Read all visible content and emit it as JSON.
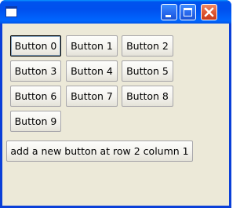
{
  "window": {
    "icons": {
      "app": "window-icon",
      "minimize": "minimize-icon",
      "maximize": "maximize-icon",
      "close": "close-icon"
    },
    "colors": {
      "titlebar": "#0053ee",
      "close_button": "#e05a36",
      "client_background": "#ece9d8"
    }
  },
  "buttons": [
    {
      "label": "Button 0"
    },
    {
      "label": "Button 1"
    },
    {
      "label": "Button 2"
    },
    {
      "label": "Button 3"
    },
    {
      "label": "Button 4"
    },
    {
      "label": "Button 5"
    },
    {
      "label": "Button 6"
    },
    {
      "label": "Button 7"
    },
    {
      "label": "Button 8"
    },
    {
      "label": "Button 9"
    }
  ],
  "add_button": {
    "label": "add a new button at row 2 column 1"
  }
}
